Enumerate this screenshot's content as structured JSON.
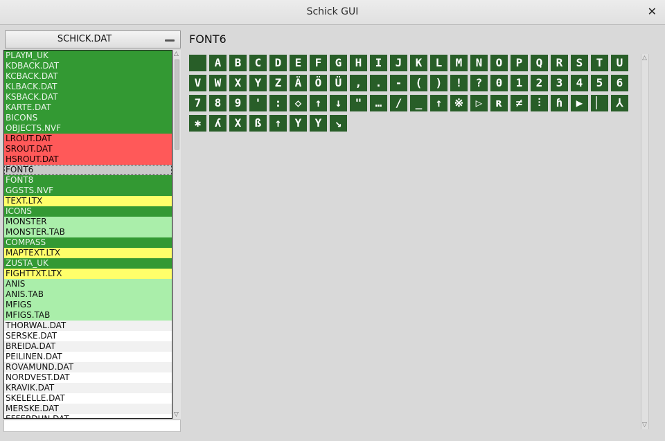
{
  "window": {
    "title": "Schick GUI",
    "close_glyph": "✕"
  },
  "file_select": {
    "selected": "SCHICK.DAT"
  },
  "file_list": [
    {
      "label": "PLAYM_UK",
      "style": "dg"
    },
    {
      "label": "KDBACK.DAT",
      "style": "dg"
    },
    {
      "label": "KCBACK.DAT",
      "style": "dg"
    },
    {
      "label": "KLBACK.DAT",
      "style": "dg"
    },
    {
      "label": "KSBACK.DAT",
      "style": "dg"
    },
    {
      "label": "KARTE.DAT",
      "style": "dg"
    },
    {
      "label": "BICONS",
      "style": "dg"
    },
    {
      "label": "OBJECTS.NVF",
      "style": "dg"
    },
    {
      "label": "LROUT.DAT",
      "style": "rd"
    },
    {
      "label": "SROUT.DAT",
      "style": "rd"
    },
    {
      "label": "HSROUT.DAT",
      "style": "rd"
    },
    {
      "label": "FONT6",
      "style": "sel"
    },
    {
      "label": "FONT8",
      "style": "dg"
    },
    {
      "label": "GGSTS.NVF",
      "style": "dg"
    },
    {
      "label": "TEXT.LTX",
      "style": "yl"
    },
    {
      "label": "ICONS",
      "style": "dg"
    },
    {
      "label": "MONSTER",
      "style": "lg"
    },
    {
      "label": "MONSTER.TAB",
      "style": "lg"
    },
    {
      "label": "COMPASS",
      "style": "dg"
    },
    {
      "label": "MAPTEXT.LTX",
      "style": "yl"
    },
    {
      "label": "ZUSTA_UK",
      "style": "dg"
    },
    {
      "label": "FIGHTTXT.LTX",
      "style": "yl"
    },
    {
      "label": "ANIS",
      "style": "lg"
    },
    {
      "label": "ANIS.TAB",
      "style": "lg"
    },
    {
      "label": "MFIGS",
      "style": "lg"
    },
    {
      "label": "MFIGS.TAB",
      "style": "lg"
    },
    {
      "label": "THORWAL.DAT",
      "style": "w1"
    },
    {
      "label": "SERSKE.DAT",
      "style": "w2"
    },
    {
      "label": "BREIDA.DAT",
      "style": "w1"
    },
    {
      "label": "PEILINEN.DAT",
      "style": "w2"
    },
    {
      "label": "ROVAMUND.DAT",
      "style": "w1"
    },
    {
      "label": "NORDVEST.DAT",
      "style": "w2"
    },
    {
      "label": "KRAVIK.DAT",
      "style": "w1"
    },
    {
      "label": "SKELELLE.DAT",
      "style": "w2"
    },
    {
      "label": "MERSKE.DAT",
      "style": "w1"
    },
    {
      "label": "EFFERDUN.DAT",
      "style": "w2"
    }
  ],
  "viewer": {
    "heading": "FONT6",
    "glyph_color": "#285e28",
    "glyphs": [
      "",
      "A",
      "B",
      "C",
      "D",
      "E",
      "F",
      "G",
      "H",
      "I",
      "J",
      "K",
      "L",
      "M",
      "N",
      "O",
      "P",
      "Q",
      "R",
      "S",
      "T",
      "U",
      "V",
      "W",
      "X",
      "Y",
      "Z",
      "Ä",
      "Ö",
      "Ü",
      ",",
      ".",
      "-",
      "(",
      ")",
      "!",
      "?",
      "0",
      "1",
      "2",
      "3",
      "4",
      "5",
      "6",
      "7",
      "8",
      "9",
      "'",
      ":",
      "◇",
      "↑",
      "↓",
      "\"",
      "…",
      "/",
      "_",
      "↑",
      "※",
      "▷",
      "ʀ",
      "≠",
      "⫶",
      "ɦ",
      "▶",
      "▏",
      "⅄",
      "✱",
      "ʎ",
      "X",
      "ß",
      "↑",
      "Y",
      "Y",
      "↘"
    ]
  },
  "accent_colors": {
    "dark_green": "#339933",
    "red": "#ff5959",
    "yellow": "#ffff6a",
    "light_green": "#aaeeaa"
  }
}
